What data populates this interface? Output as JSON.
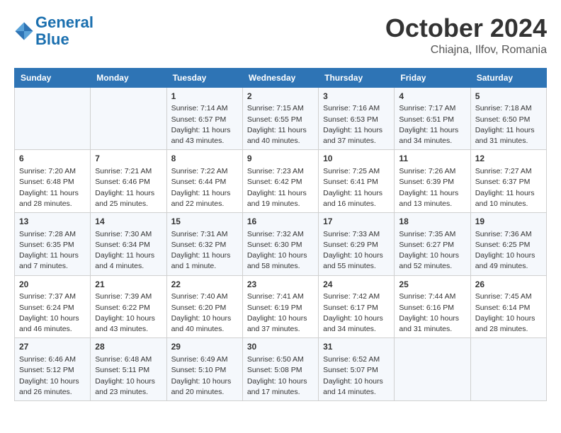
{
  "logo": {
    "line1": "General",
    "line2": "Blue"
  },
  "title": "October 2024",
  "location": "Chiajna, Ilfov, Romania",
  "header_days": [
    "Sunday",
    "Monday",
    "Tuesday",
    "Wednesday",
    "Thursday",
    "Friday",
    "Saturday"
  ],
  "weeks": [
    [
      {
        "day": "",
        "info": ""
      },
      {
        "day": "",
        "info": ""
      },
      {
        "day": "1",
        "info": "Sunrise: 7:14 AM\nSunset: 6:57 PM\nDaylight: 11 hours\nand 43 minutes."
      },
      {
        "day": "2",
        "info": "Sunrise: 7:15 AM\nSunset: 6:55 PM\nDaylight: 11 hours\nand 40 minutes."
      },
      {
        "day": "3",
        "info": "Sunrise: 7:16 AM\nSunset: 6:53 PM\nDaylight: 11 hours\nand 37 minutes."
      },
      {
        "day": "4",
        "info": "Sunrise: 7:17 AM\nSunset: 6:51 PM\nDaylight: 11 hours\nand 34 minutes."
      },
      {
        "day": "5",
        "info": "Sunrise: 7:18 AM\nSunset: 6:50 PM\nDaylight: 11 hours\nand 31 minutes."
      }
    ],
    [
      {
        "day": "6",
        "info": "Sunrise: 7:20 AM\nSunset: 6:48 PM\nDaylight: 11 hours\nand 28 minutes."
      },
      {
        "day": "7",
        "info": "Sunrise: 7:21 AM\nSunset: 6:46 PM\nDaylight: 11 hours\nand 25 minutes."
      },
      {
        "day": "8",
        "info": "Sunrise: 7:22 AM\nSunset: 6:44 PM\nDaylight: 11 hours\nand 22 minutes."
      },
      {
        "day": "9",
        "info": "Sunrise: 7:23 AM\nSunset: 6:42 PM\nDaylight: 11 hours\nand 19 minutes."
      },
      {
        "day": "10",
        "info": "Sunrise: 7:25 AM\nSunset: 6:41 PM\nDaylight: 11 hours\nand 16 minutes."
      },
      {
        "day": "11",
        "info": "Sunrise: 7:26 AM\nSunset: 6:39 PM\nDaylight: 11 hours\nand 13 minutes."
      },
      {
        "day": "12",
        "info": "Sunrise: 7:27 AM\nSunset: 6:37 PM\nDaylight: 11 hours\nand 10 minutes."
      }
    ],
    [
      {
        "day": "13",
        "info": "Sunrise: 7:28 AM\nSunset: 6:35 PM\nDaylight: 11 hours\nand 7 minutes."
      },
      {
        "day": "14",
        "info": "Sunrise: 7:30 AM\nSunset: 6:34 PM\nDaylight: 11 hours\nand 4 minutes."
      },
      {
        "day": "15",
        "info": "Sunrise: 7:31 AM\nSunset: 6:32 PM\nDaylight: 11 hours\nand 1 minute."
      },
      {
        "day": "16",
        "info": "Sunrise: 7:32 AM\nSunset: 6:30 PM\nDaylight: 10 hours\nand 58 minutes."
      },
      {
        "day": "17",
        "info": "Sunrise: 7:33 AM\nSunset: 6:29 PM\nDaylight: 10 hours\nand 55 minutes."
      },
      {
        "day": "18",
        "info": "Sunrise: 7:35 AM\nSunset: 6:27 PM\nDaylight: 10 hours\nand 52 minutes."
      },
      {
        "day": "19",
        "info": "Sunrise: 7:36 AM\nSunset: 6:25 PM\nDaylight: 10 hours\nand 49 minutes."
      }
    ],
    [
      {
        "day": "20",
        "info": "Sunrise: 7:37 AM\nSunset: 6:24 PM\nDaylight: 10 hours\nand 46 minutes."
      },
      {
        "day": "21",
        "info": "Sunrise: 7:39 AM\nSunset: 6:22 PM\nDaylight: 10 hours\nand 43 minutes."
      },
      {
        "day": "22",
        "info": "Sunrise: 7:40 AM\nSunset: 6:20 PM\nDaylight: 10 hours\nand 40 minutes."
      },
      {
        "day": "23",
        "info": "Sunrise: 7:41 AM\nSunset: 6:19 PM\nDaylight: 10 hours\nand 37 minutes."
      },
      {
        "day": "24",
        "info": "Sunrise: 7:42 AM\nSunset: 6:17 PM\nDaylight: 10 hours\nand 34 minutes."
      },
      {
        "day": "25",
        "info": "Sunrise: 7:44 AM\nSunset: 6:16 PM\nDaylight: 10 hours\nand 31 minutes."
      },
      {
        "day": "26",
        "info": "Sunrise: 7:45 AM\nSunset: 6:14 PM\nDaylight: 10 hours\nand 28 minutes."
      }
    ],
    [
      {
        "day": "27",
        "info": "Sunrise: 6:46 AM\nSunset: 5:12 PM\nDaylight: 10 hours\nand 26 minutes."
      },
      {
        "day": "28",
        "info": "Sunrise: 6:48 AM\nSunset: 5:11 PM\nDaylight: 10 hours\nand 23 minutes."
      },
      {
        "day": "29",
        "info": "Sunrise: 6:49 AM\nSunset: 5:10 PM\nDaylight: 10 hours\nand 20 minutes."
      },
      {
        "day": "30",
        "info": "Sunrise: 6:50 AM\nSunset: 5:08 PM\nDaylight: 10 hours\nand 17 minutes."
      },
      {
        "day": "31",
        "info": "Sunrise: 6:52 AM\nSunset: 5:07 PM\nDaylight: 10 hours\nand 14 minutes."
      },
      {
        "day": "",
        "info": ""
      },
      {
        "day": "",
        "info": ""
      }
    ]
  ]
}
